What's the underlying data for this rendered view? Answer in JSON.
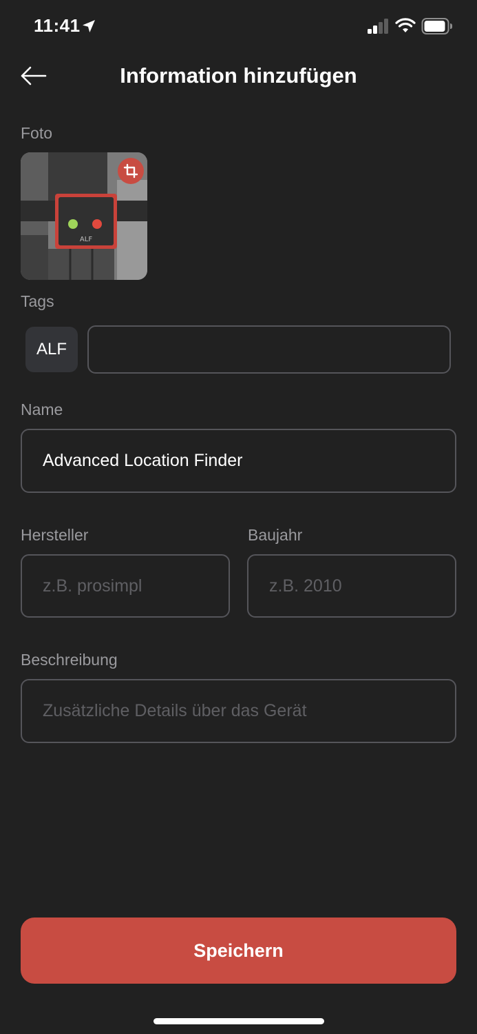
{
  "status_bar": {
    "time": "11:41",
    "icons": [
      "location-arrow-icon",
      "cellular-signal-icon",
      "wifi-icon",
      "battery-icon"
    ]
  },
  "header": {
    "title": "Information hinzufügen",
    "back_icon": "arrow-left-icon"
  },
  "photo": {
    "label": "Foto",
    "badge_icon": "crop-icon",
    "device_label": "ALF"
  },
  "tags": {
    "label": "Tags",
    "items": [
      "ALF"
    ],
    "input_value": ""
  },
  "name": {
    "label": "Name",
    "value": "Advanced Location Finder"
  },
  "manufacturer": {
    "label": "Hersteller",
    "placeholder": "z.B. prosimpl"
  },
  "year": {
    "label": "Baujahr",
    "placeholder": "z.B. 2010"
  },
  "description": {
    "label": "Beschreibung",
    "placeholder": "Zusätzliche Details über das Gerät"
  },
  "actions": {
    "save_label": "Speichern"
  },
  "colors": {
    "background": "#212121",
    "accent": "#c84c42",
    "border": "#55555a",
    "label": "#9a9a9e",
    "placeholder": "#5f5f63",
    "chip": "#333438"
  }
}
